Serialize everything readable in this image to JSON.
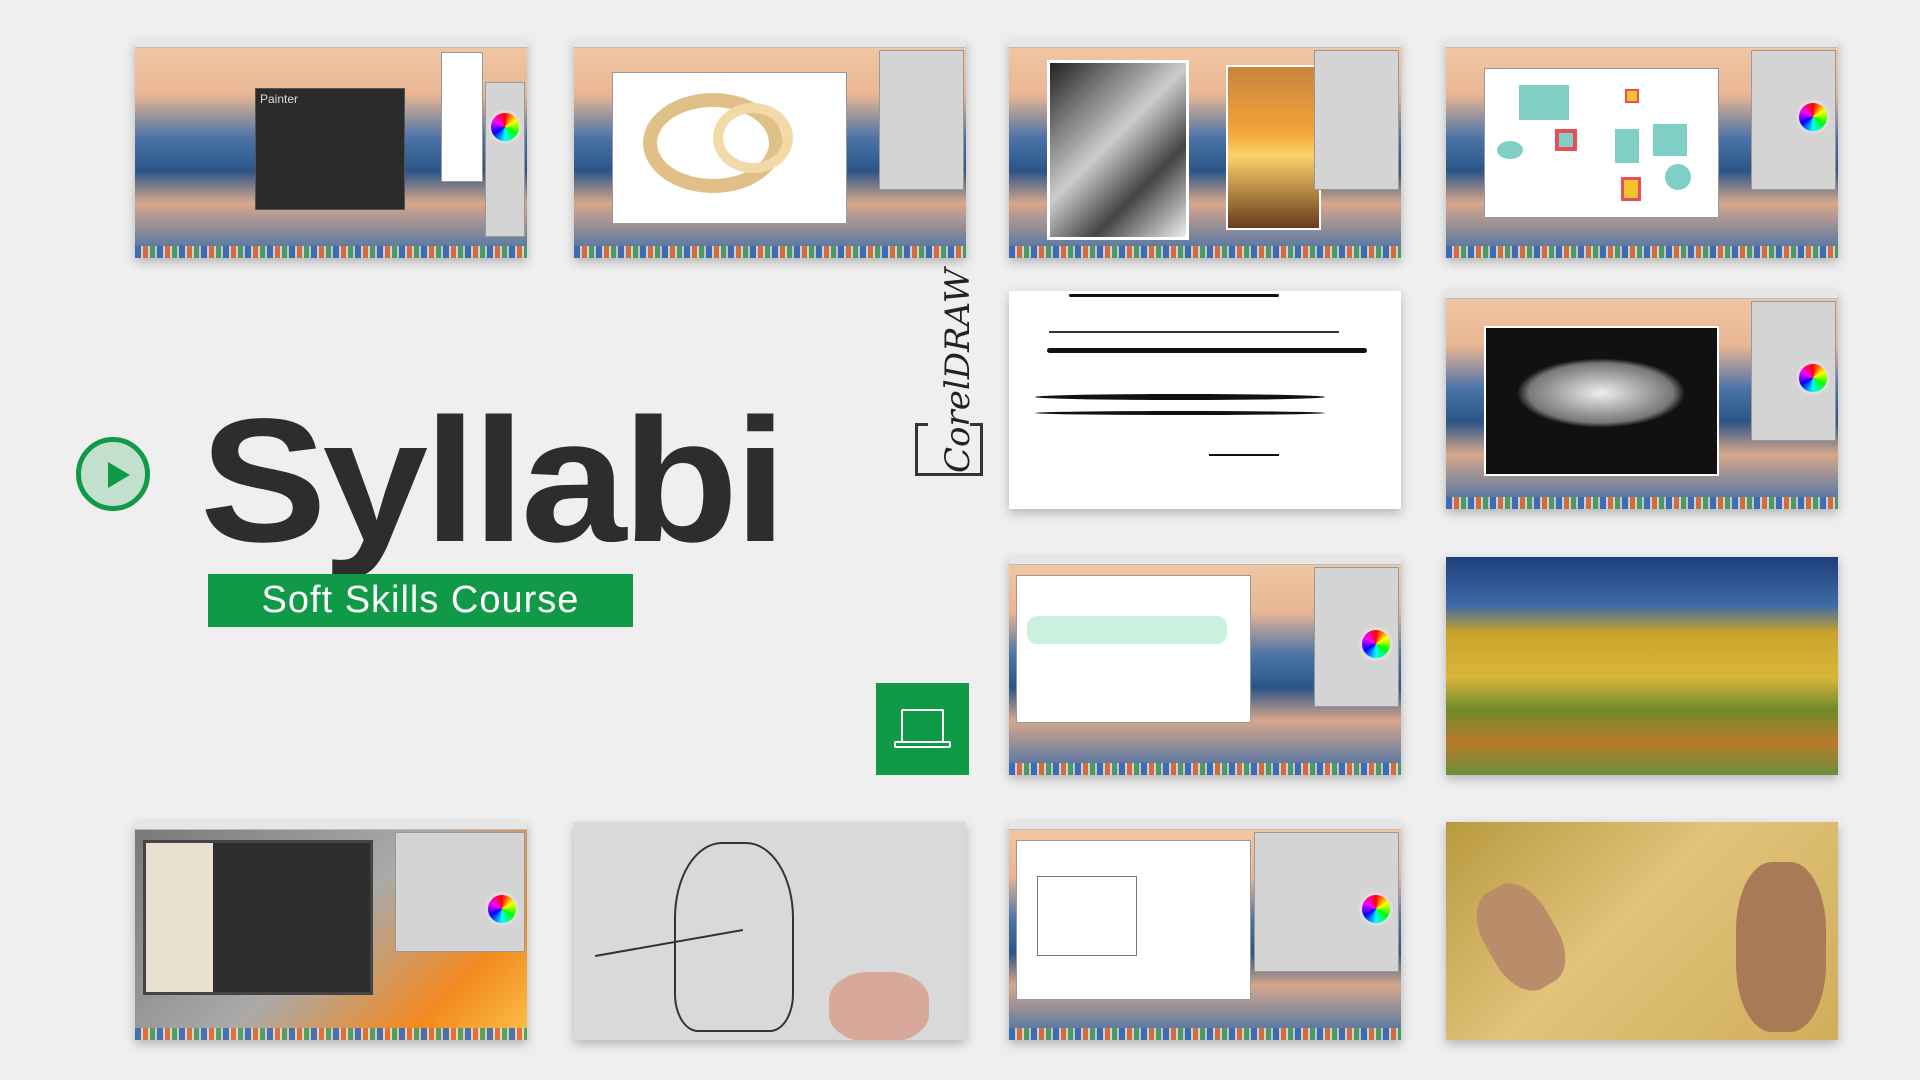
{
  "title": "Syllabi",
  "subtitle": "Soft Skills Course",
  "logo_text": "CorelDRAW",
  "thumbnail_1_dialog_title": "Painter",
  "colors": {
    "accent": "#109a47",
    "title": "#2d2d2d",
    "background": "#efefef"
  },
  "icons": {
    "play": "play-circle-icon",
    "laptop": "laptop-icon"
  }
}
